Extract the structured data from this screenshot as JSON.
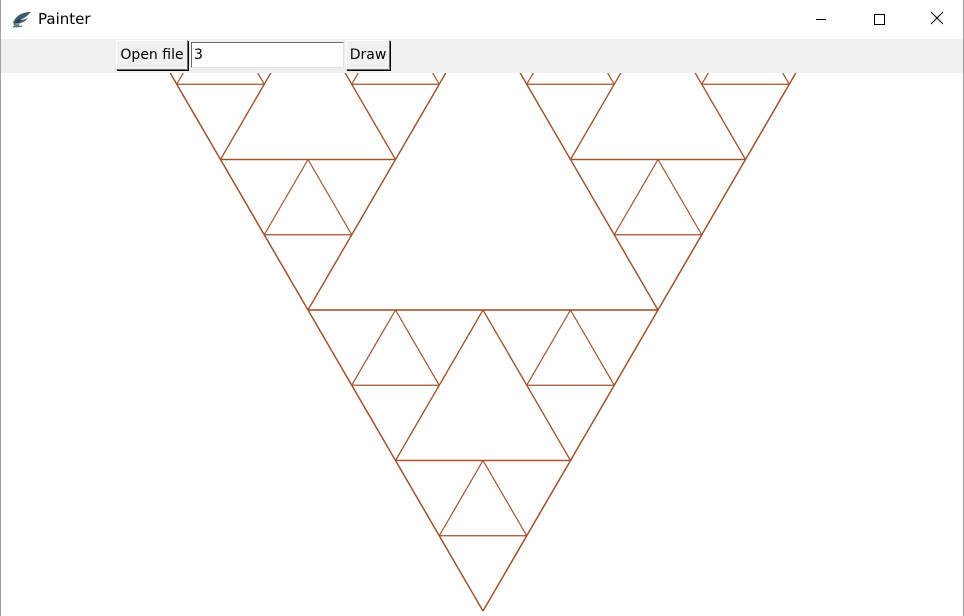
{
  "window": {
    "title": "Painter",
    "app_icon": "feather-snake-icon",
    "controls": {
      "minimize_icon": "minimize-icon",
      "maximize_icon": "maximize-icon",
      "close_icon": "close-icon"
    }
  },
  "toolbar": {
    "open_label": "Open file",
    "depth_value": "3",
    "draw_label": "Draw"
  },
  "canvas": {
    "background": "#ffffff",
    "stroke_color": "#a0522d",
    "fractal": "sierpinski-triangle-inverted",
    "depth": 3
  }
}
